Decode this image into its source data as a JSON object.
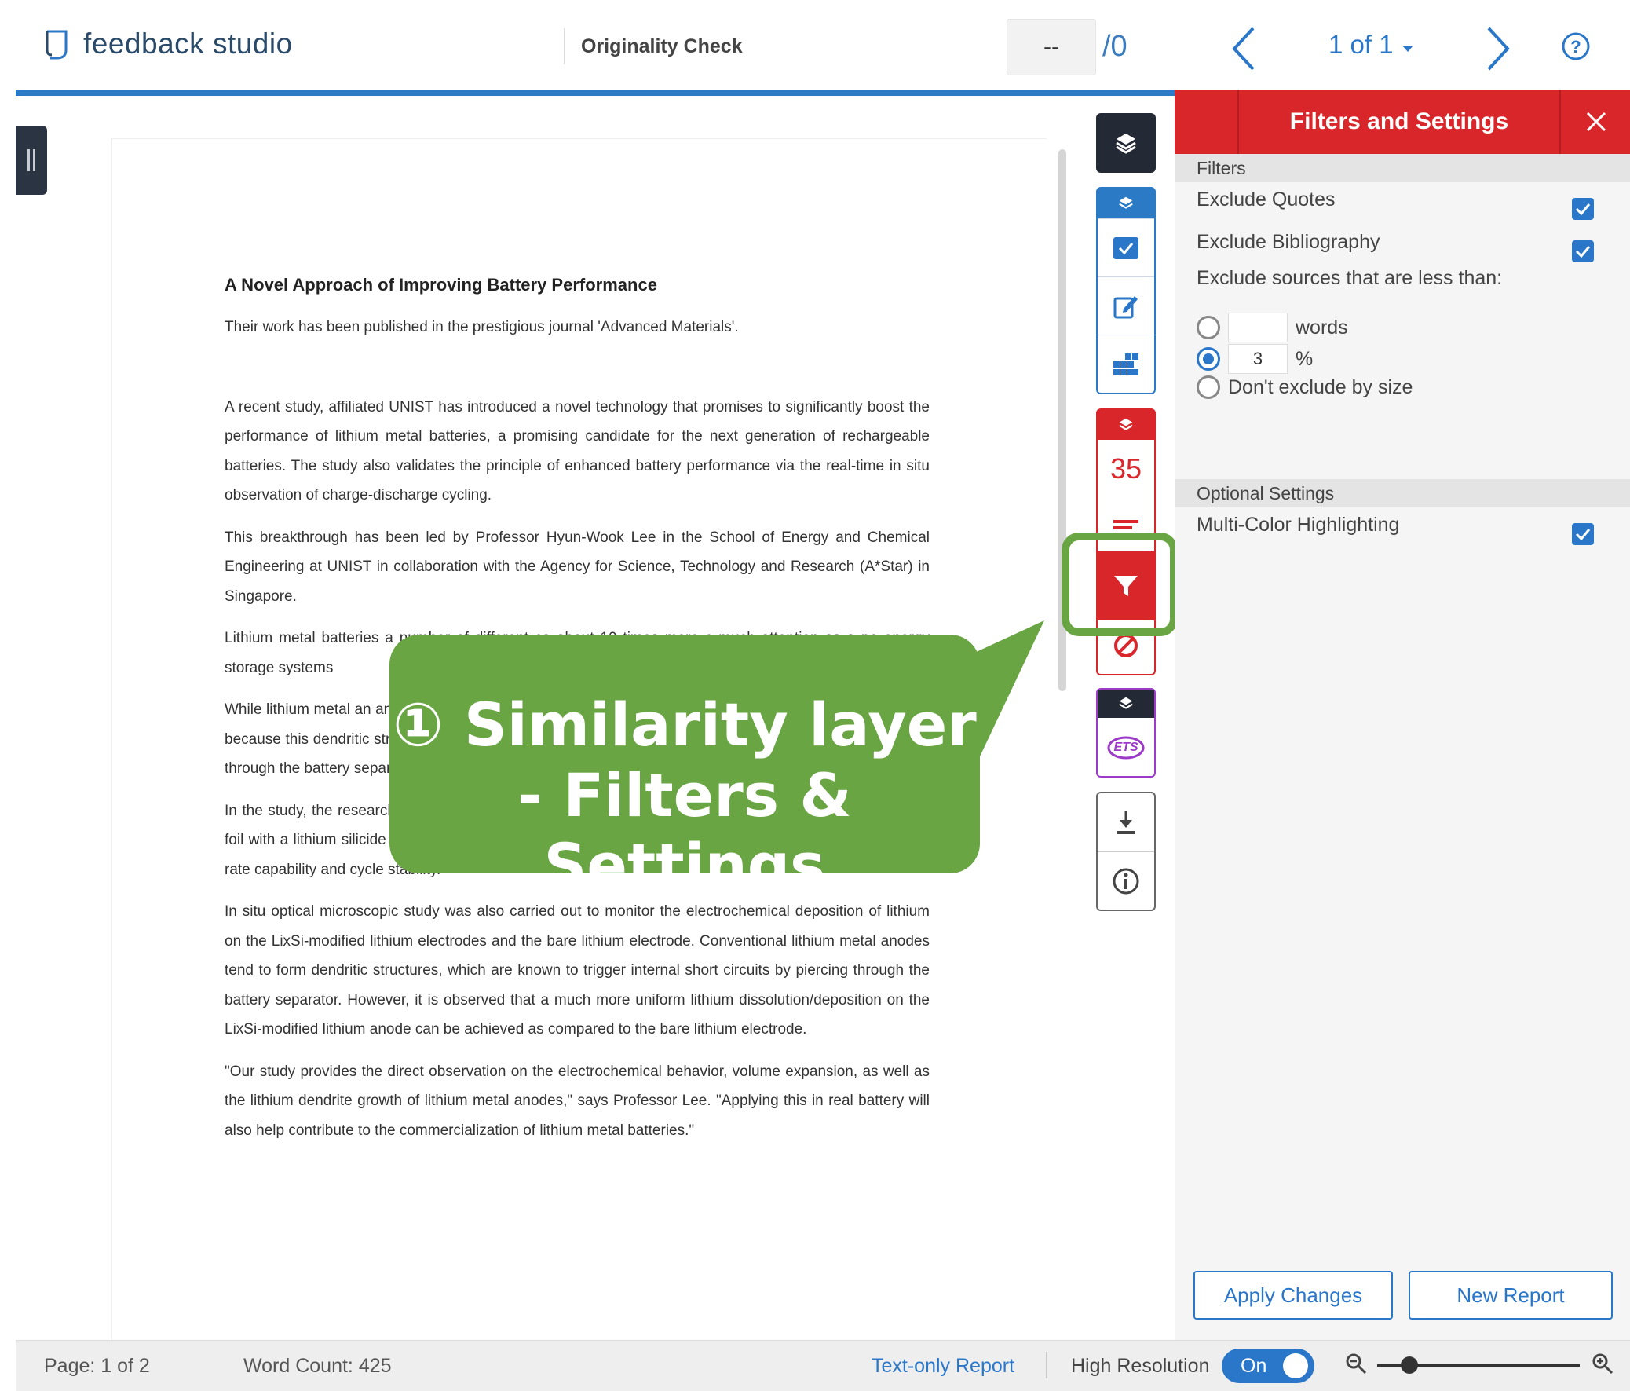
{
  "header": {
    "app_name": "feedback studio",
    "document_title": "Originality Check",
    "score_value": "--",
    "score_total": "/0",
    "page_selector": "1 of 1"
  },
  "document": {
    "title": "A Novel Approach of Improving Battery Performance",
    "paragraphs": [
      "Their work has been published in the prestigious journal 'Advanced Materials'.",
      "A recent study, affiliated UNIST has introduced a novel technology that promises to significantly boost the performance of lithium metal batteries, a promising candidate for the next generation of rechargeable batteries. The study also validates the principle of enhanced battery performance via the real-time in situ observation of charge-discharge cycling.",
      "This breakthrough has been led by Professor Hyun-Wook Lee in the School of Energy and Chemical Engineering at UNIST in collaboration with the Agency for Science, Technology and Research (A*Star) in Singapore.",
      "Lithium metal batteries a number of different ca about 10 times more c much attention as a po energy storage systems",
      "While lithium metal an an anode in commercia dendritic structures durin result in poor performance. This is because this dendritic structure on the lithium metal surface layer triggers internal short circuits by piercing through the battery separator.",
      "In the study, the research team suppressed dendritic growth of lithium metal anode by coating the lithium foil with a lithium silicide (LixSi) layer. Results showed excellent electrochemical performances in terms of rate capability and cycle stability.",
      "In situ optical microscopic study was also carried out to monitor the electrochemical deposition of lithium on the LixSi-modified lithium electrodes and the bare lithium electrode. Conventional lithium metal anodes tend to form dendritic structures, which are known to trigger internal short circuits by piercing through the battery separator. However, it is observed that a much more uniform lithium dissolution/deposition on the LixSi-modified lithium anode can be achieved as compared to the bare lithium electrode.",
      "\"Our study provides the direct observation on the electrochemical behavior, volume expansion, as well as the lithium dendrite growth of lithium metal anodes,\" says Professor Lee. \"Applying this in real battery will also help contribute to the commercialization of lithium metal batteries.\""
    ]
  },
  "callout": {
    "line1": "① Similarity layer",
    "line2": "- Filters & Settings"
  },
  "rail": {
    "similarity_count": "35",
    "ets_label": "ETS"
  },
  "panel": {
    "title": "Filters and Settings",
    "filters_header": "Filters",
    "exclude_quotes": "Exclude Quotes",
    "exclude_bibliography": "Exclude Bibliography",
    "exclude_sources_label": "Exclude sources that are less than:",
    "words_label": "words",
    "words_value": "",
    "percent_label": "%",
    "percent_value": "3",
    "dont_exclude_label": "Don't exclude by size",
    "optional_header": "Optional Settings",
    "multicolor_label": "Multi-Color Highlighting",
    "apply_button": "Apply Changes",
    "new_report_button": "New Report"
  },
  "status": {
    "page_info": "Page: 1 of 2",
    "word_count": "Word Count: 425",
    "text_only_report": "Text-only Report",
    "high_resolution": "High Resolution",
    "toggle_state": "On"
  },
  "colors": {
    "brand_blue": "#2a77c9",
    "accent_red": "#d9262b",
    "callout_green": "#6aa544",
    "dark_rail": "#242a35",
    "ets_purple": "#9b3bc8"
  },
  "icons": {
    "logo": "feedback-studio-logo-icon",
    "layers": "layers-icon",
    "checkbox": "check-square-icon",
    "edit": "edit-icon",
    "grid": "grid-icon",
    "list": "list-icon",
    "filter": "filter-icon",
    "exclude": "no-entry-icon",
    "download": "download-icon",
    "info": "info-icon",
    "help": "question-circle-icon",
    "zoom_out": "zoom-out-icon",
    "zoom_in": "zoom-in-icon"
  }
}
